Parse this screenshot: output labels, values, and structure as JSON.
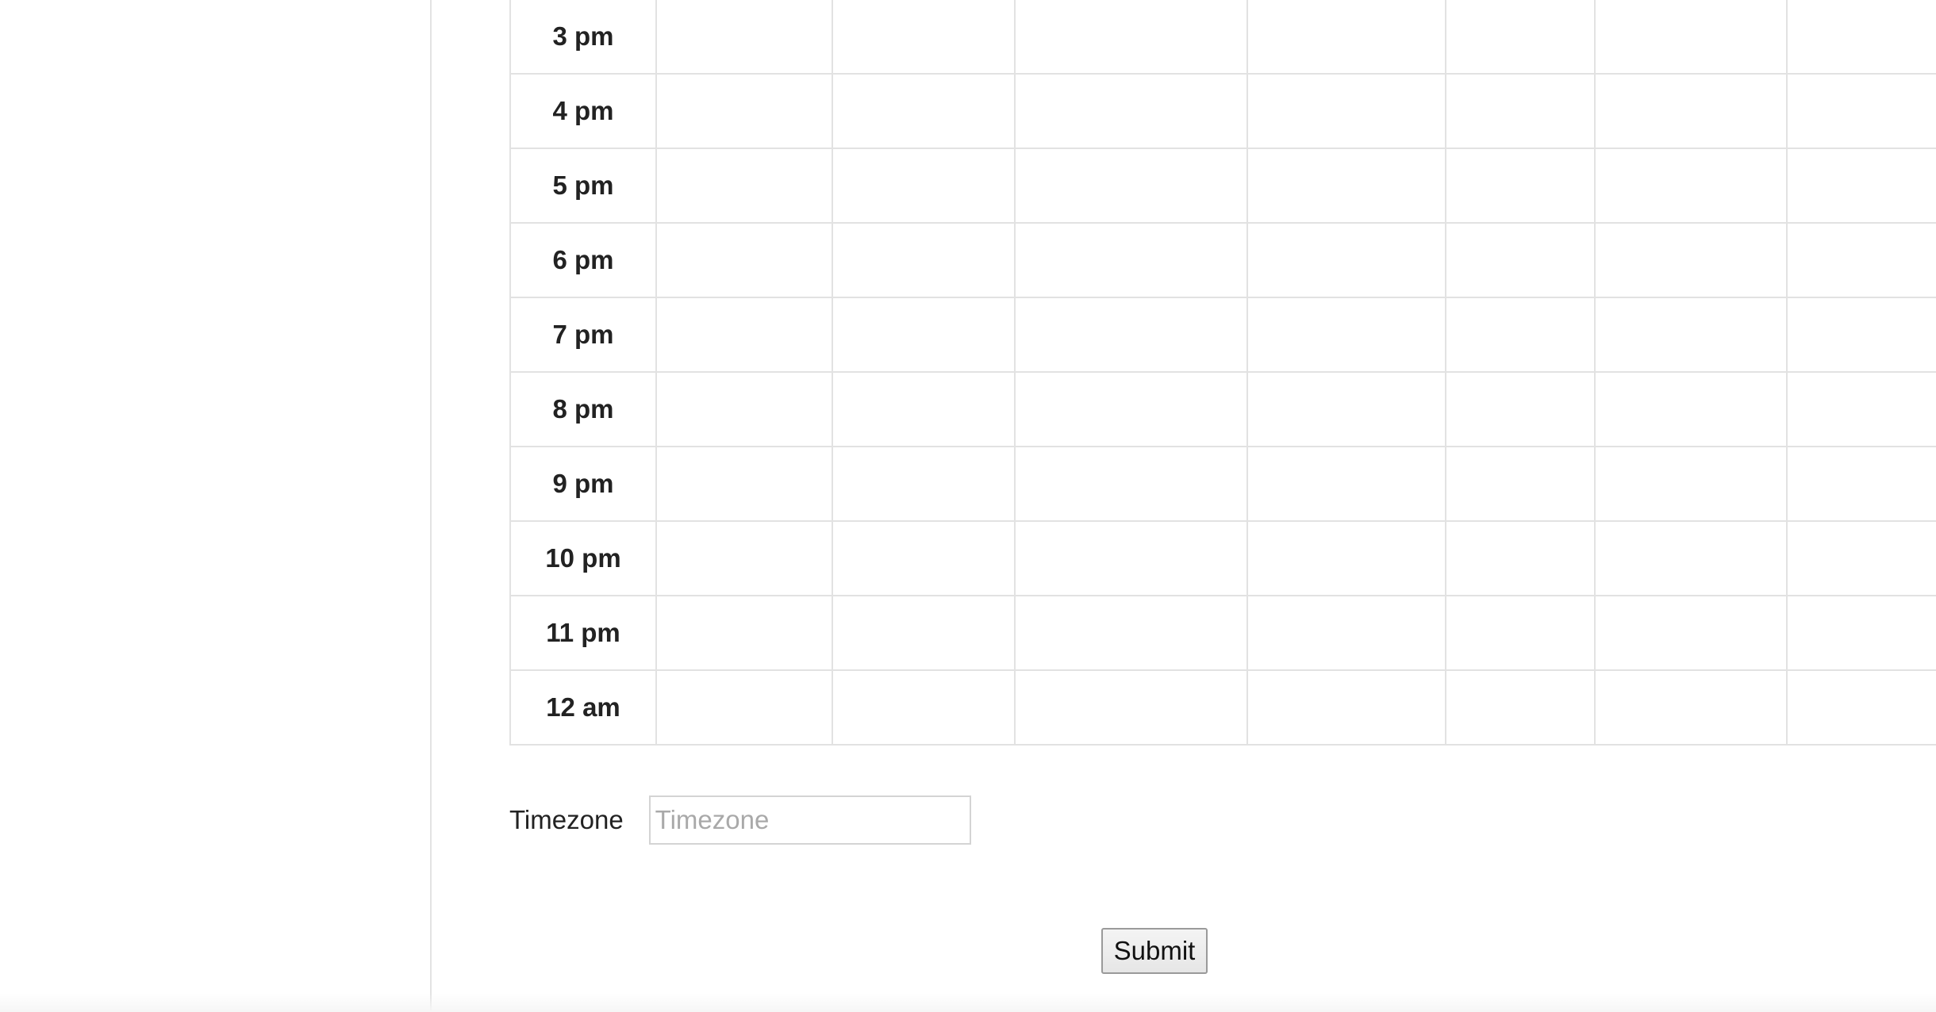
{
  "schedule": {
    "rows": [
      {
        "time": "3 pm"
      },
      {
        "time": "4 pm"
      },
      {
        "time": "5 pm"
      },
      {
        "time": "6 pm"
      },
      {
        "time": "7 pm"
      },
      {
        "time": "8 pm"
      },
      {
        "time": "9 pm"
      },
      {
        "time": "10 pm"
      },
      {
        "time": "11 pm"
      },
      {
        "time": "12 am"
      }
    ],
    "slot_columns": 8
  },
  "timezone": {
    "label": "Timezone",
    "placeholder": "Timezone",
    "value": ""
  },
  "form": {
    "submit_label": "Submit"
  }
}
